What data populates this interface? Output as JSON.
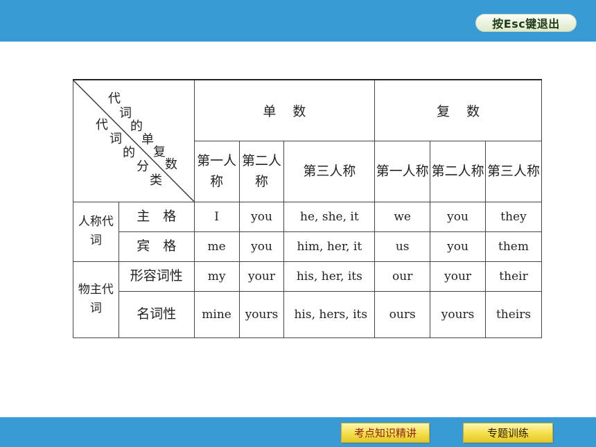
{
  "header": {
    "esc_label": "按Esc键退出"
  },
  "table": {
    "corner": {
      "top_chars": [
        "代",
        "词",
        "的",
        "单",
        "复",
        "数"
      ],
      "bottom_chars": [
        "代",
        "词",
        "的",
        "分",
        "类"
      ]
    },
    "singular": "单数",
    "plural": "复数",
    "persons": [
      "第一人称",
      "第二人称",
      "第三人称",
      "第一人称",
      "第二人称",
      "第三人称"
    ],
    "group_personal": "人称代词",
    "group_possessive": "物主代词",
    "rows": [
      {
        "label": "主　格",
        "cells": [
          "I",
          "you",
          "he, she, it",
          "we",
          "you",
          "they"
        ]
      },
      {
        "label": "宾　格",
        "cells": [
          "me",
          "you",
          "him, her, it",
          "us",
          "you",
          "them"
        ]
      },
      {
        "label": "形容词性",
        "cells": [
          "my",
          "your",
          "his, her, its",
          "our",
          "your",
          "their"
        ]
      },
      {
        "label": "名词性",
        "cells": [
          "mine",
          "yours",
          "his, hers, its",
          "ours",
          "yours",
          "theirs"
        ]
      }
    ]
  },
  "footer": {
    "btn_knowledge": "考点知识精讲",
    "btn_training": "专题训练"
  }
}
